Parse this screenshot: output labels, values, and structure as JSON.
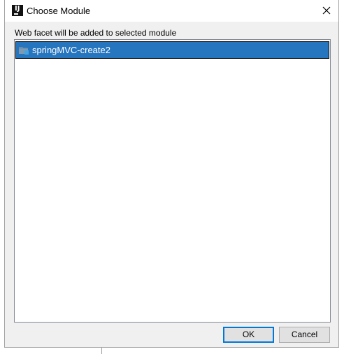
{
  "window": {
    "title": "Choose Module",
    "app_icon": "intellij-idea-icon",
    "close_icon": "close-icon"
  },
  "caption": "Web facet will be added to selected module",
  "modules": [
    {
      "label": "springMVC-create2",
      "icon": "module-folder-icon",
      "selected": true
    }
  ],
  "buttons": {
    "ok": "OK",
    "cancel": "Cancel"
  },
  "colors": {
    "selection": "#2675bf",
    "default_button_border": "#0078d7",
    "dialog_bg": "#f0f0f0"
  }
}
